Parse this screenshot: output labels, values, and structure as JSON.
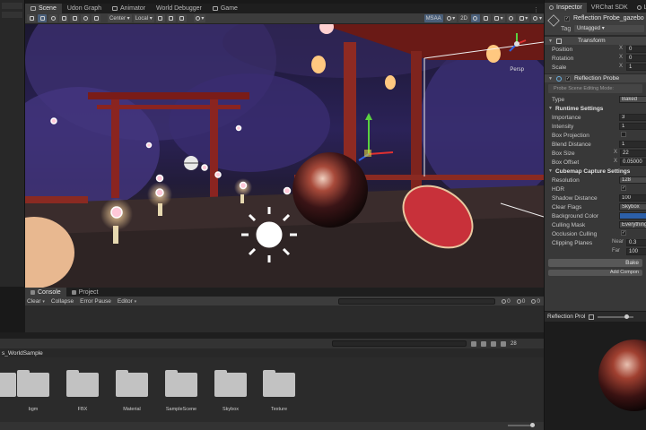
{
  "scene_tabs": [
    {
      "label": "Scene",
      "active": true
    },
    {
      "label": "Udon Graph",
      "active": false
    },
    {
      "label": "Animator",
      "active": false
    },
    {
      "label": "World Debugger",
      "active": false
    },
    {
      "label": "Game",
      "active": false
    }
  ],
  "toolbar": {
    "pivot_label": "Center",
    "space_label": "Local",
    "msaa_label": "MSAA",
    "mode_2d_label": "2D",
    "perspective_label": "Persp"
  },
  "console": {
    "tabs": [
      {
        "label": "Console",
        "active": true
      },
      {
        "label": "Project",
        "active": false
      }
    ],
    "clear_label": "Clear",
    "collapse_label": "Collapse",
    "error_pause_label": "Error Pause",
    "editor_label": "Editor",
    "log_count": "0",
    "warn_count": "0",
    "error_count": "0"
  },
  "project": {
    "breadcrumb": "s_WorldSample",
    "hidden_count": "28",
    "folders": [
      "bgm",
      "FBX",
      "Material",
      "SampleScene",
      "Skybox",
      "Texture"
    ]
  },
  "inspector": {
    "tabs": [
      {
        "label": "Inspector",
        "active": true
      },
      {
        "label": "VRChat SDK",
        "active": false
      },
      {
        "label": "Li",
        "active": false
      }
    ],
    "object_name": "Reflection Probe_gazebo",
    "tag_label": "Tag",
    "tag_value": "Untagged",
    "transform": {
      "title": "Transform",
      "position_label": "Position",
      "rotation_label": "Rotation",
      "scale_label": "Scale",
      "axis_label": "X",
      "position_x": "0",
      "rotation_x": "0",
      "scale_x": "1"
    },
    "reflection_probe": {
      "title": "Reflection Probe",
      "edit_mode_label": "Probe Scene Editing Mode:",
      "type_label": "Type",
      "type_value": "Baked",
      "runtime_settings": "Runtime Settings",
      "importance_label": "Importance",
      "importance_value": "3",
      "intensity_label": "Intensity",
      "intensity_value": "1",
      "box_projection_label": "Box Projection",
      "blend_distance_label": "Blend Distance",
      "blend_distance_value": "1",
      "box_size_label": "Box Size",
      "box_size_x": "22",
      "box_offset_label": "Box Offset",
      "box_offset_x": "0.05000",
      "cubemap_settings": "Cubemap Capture Settings",
      "resolution_label": "Resolution",
      "resolution_value": "128",
      "hdr_label": "HDR",
      "shadow_distance_label": "Shadow Distance",
      "shadow_distance_value": "100",
      "clear_flags_label": "Clear Flags",
      "clear_flags_value": "Skybox",
      "background_color_label": "Background Color",
      "background_color": "#2c5fa8",
      "culling_mask_label": "Culling Mask",
      "culling_mask_value": "Everything",
      "occlusion_culling_label": "Occlusion Culling",
      "clipping_planes_label": "Clipping Planes",
      "near_label": "Near",
      "near_value": "0.3",
      "far_label": "Far",
      "far_value": "100",
      "bake_label": "Bake"
    },
    "add_component_label": "Add Compon",
    "preview_title": "Reflection Prol"
  }
}
